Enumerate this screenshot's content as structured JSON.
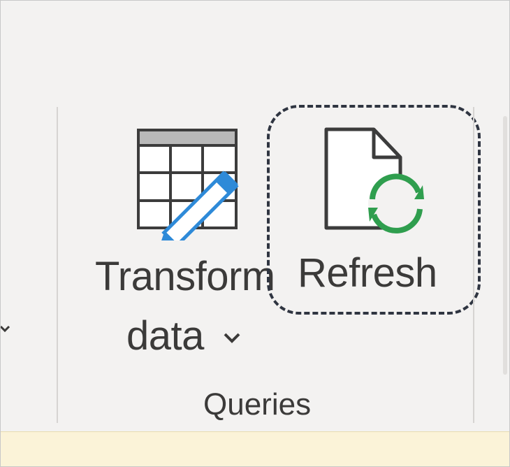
{
  "ribbon": {
    "group": {
      "label": "Queries",
      "buttons": [
        {
          "id": "transform",
          "label_line1": "Transform",
          "label_line2": "data",
          "icon": "table-edit-icon",
          "has_dropdown": true
        },
        {
          "id": "refresh",
          "label": "Refresh",
          "icon": "document-refresh-icon",
          "focused": true
        }
      ]
    }
  },
  "colors": {
    "ribbon_bg": "#f3f2f1",
    "text": "#3b3a39",
    "pencil_blue": "#2e8ad8",
    "refresh_green": "#2f9e4e",
    "focus_ring": "#2f3541",
    "info_bar": "#fbf3d8"
  }
}
